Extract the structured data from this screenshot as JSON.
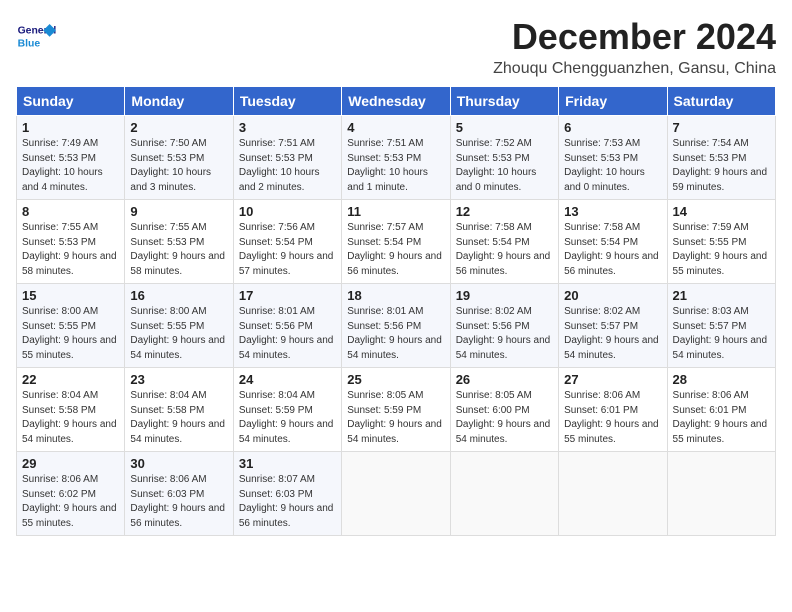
{
  "header": {
    "logo_general": "General",
    "logo_blue": "Blue",
    "month_title": "December 2024",
    "location": "Zhouqu Chengguanzhen, Gansu, China"
  },
  "weekdays": [
    "Sunday",
    "Monday",
    "Tuesday",
    "Wednesday",
    "Thursday",
    "Friday",
    "Saturday"
  ],
  "weeks": [
    [
      {
        "day": "1",
        "sunrise": "7:49 AM",
        "sunset": "5:53 PM",
        "daylight": "10 hours and 4 minutes."
      },
      {
        "day": "2",
        "sunrise": "7:50 AM",
        "sunset": "5:53 PM",
        "daylight": "10 hours and 3 minutes."
      },
      {
        "day": "3",
        "sunrise": "7:51 AM",
        "sunset": "5:53 PM",
        "daylight": "10 hours and 2 minutes."
      },
      {
        "day": "4",
        "sunrise": "7:51 AM",
        "sunset": "5:53 PM",
        "daylight": "10 hours and 1 minute."
      },
      {
        "day": "5",
        "sunrise": "7:52 AM",
        "sunset": "5:53 PM",
        "daylight": "10 hours and 0 minutes."
      },
      {
        "day": "6",
        "sunrise": "7:53 AM",
        "sunset": "5:53 PM",
        "daylight": "10 hours and 0 minutes."
      },
      {
        "day": "7",
        "sunrise": "7:54 AM",
        "sunset": "5:53 PM",
        "daylight": "9 hours and 59 minutes."
      }
    ],
    [
      {
        "day": "8",
        "sunrise": "7:55 AM",
        "sunset": "5:53 PM",
        "daylight": "9 hours and 58 minutes."
      },
      {
        "day": "9",
        "sunrise": "7:55 AM",
        "sunset": "5:53 PM",
        "daylight": "9 hours and 58 minutes."
      },
      {
        "day": "10",
        "sunrise": "7:56 AM",
        "sunset": "5:54 PM",
        "daylight": "9 hours and 57 minutes."
      },
      {
        "day": "11",
        "sunrise": "7:57 AM",
        "sunset": "5:54 PM",
        "daylight": "9 hours and 56 minutes."
      },
      {
        "day": "12",
        "sunrise": "7:58 AM",
        "sunset": "5:54 PM",
        "daylight": "9 hours and 56 minutes."
      },
      {
        "day": "13",
        "sunrise": "7:58 AM",
        "sunset": "5:54 PM",
        "daylight": "9 hours and 56 minutes."
      },
      {
        "day": "14",
        "sunrise": "7:59 AM",
        "sunset": "5:55 PM",
        "daylight": "9 hours and 55 minutes."
      }
    ],
    [
      {
        "day": "15",
        "sunrise": "8:00 AM",
        "sunset": "5:55 PM",
        "daylight": "9 hours and 55 minutes."
      },
      {
        "day": "16",
        "sunrise": "8:00 AM",
        "sunset": "5:55 PM",
        "daylight": "9 hours and 54 minutes."
      },
      {
        "day": "17",
        "sunrise": "8:01 AM",
        "sunset": "5:56 PM",
        "daylight": "9 hours and 54 minutes."
      },
      {
        "day": "18",
        "sunrise": "8:01 AM",
        "sunset": "5:56 PM",
        "daylight": "9 hours and 54 minutes."
      },
      {
        "day": "19",
        "sunrise": "8:02 AM",
        "sunset": "5:56 PM",
        "daylight": "9 hours and 54 minutes."
      },
      {
        "day": "20",
        "sunrise": "8:02 AM",
        "sunset": "5:57 PM",
        "daylight": "9 hours and 54 minutes."
      },
      {
        "day": "21",
        "sunrise": "8:03 AM",
        "sunset": "5:57 PM",
        "daylight": "9 hours and 54 minutes."
      }
    ],
    [
      {
        "day": "22",
        "sunrise": "8:04 AM",
        "sunset": "5:58 PM",
        "daylight": "9 hours and 54 minutes."
      },
      {
        "day": "23",
        "sunrise": "8:04 AM",
        "sunset": "5:58 PM",
        "daylight": "9 hours and 54 minutes."
      },
      {
        "day": "24",
        "sunrise": "8:04 AM",
        "sunset": "5:59 PM",
        "daylight": "9 hours and 54 minutes."
      },
      {
        "day": "25",
        "sunrise": "8:05 AM",
        "sunset": "5:59 PM",
        "daylight": "9 hours and 54 minutes."
      },
      {
        "day": "26",
        "sunrise": "8:05 AM",
        "sunset": "6:00 PM",
        "daylight": "9 hours and 54 minutes."
      },
      {
        "day": "27",
        "sunrise": "8:06 AM",
        "sunset": "6:01 PM",
        "daylight": "9 hours and 55 minutes."
      },
      {
        "day": "28",
        "sunrise": "8:06 AM",
        "sunset": "6:01 PM",
        "daylight": "9 hours and 55 minutes."
      }
    ],
    [
      {
        "day": "29",
        "sunrise": "8:06 AM",
        "sunset": "6:02 PM",
        "daylight": "9 hours and 55 minutes."
      },
      {
        "day": "30",
        "sunrise": "8:06 AM",
        "sunset": "6:03 PM",
        "daylight": "9 hours and 56 minutes."
      },
      {
        "day": "31",
        "sunrise": "8:07 AM",
        "sunset": "6:03 PM",
        "daylight": "9 hours and 56 minutes."
      },
      null,
      null,
      null,
      null
    ]
  ]
}
